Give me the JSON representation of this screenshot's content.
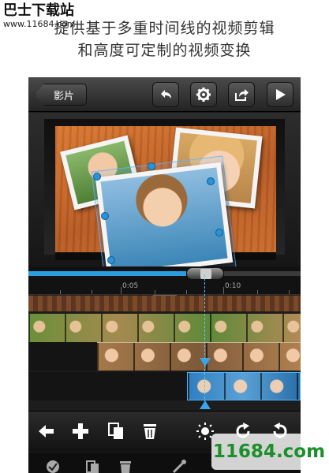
{
  "watermark": {
    "site_name": "巴士下载站",
    "site_url": "www.11684.com",
    "logo_text": "11684.com"
  },
  "caption": {
    "line1": "提供基于多重时间线的视频剪辑",
    "line2": "和高度可定制的视频变换"
  },
  "toolbar": {
    "back_label": "影片",
    "buttons": [
      "undo-icon",
      "gear-icon",
      "share-icon",
      "play-icon"
    ]
  },
  "preview": {
    "photos": [
      "child-with-teddy-photo",
      "girl-smiling-photo",
      "girl-holding-shell-photo"
    ],
    "selected_photo": "girl-holding-shell-photo"
  },
  "scrubber": {
    "position_fraction": 0.65
  },
  "ruler": {
    "ticks": [
      "0:05",
      "0:10"
    ]
  },
  "tracks": [
    {
      "name": "video-track-1",
      "clip": "girl-with-teddy-clip"
    },
    {
      "name": "video-track-2",
      "clip": "girl-holding-shell-clip"
    },
    {
      "name": "video-track-3",
      "clip": "girl-on-beach-clip"
    }
  ],
  "bottom_bar": {
    "icons": [
      "back-arrow-icon",
      "add-icon",
      "duplicate-icon",
      "delete-icon",
      "brightness-icon",
      "redo-icon",
      "rotate-icon"
    ]
  },
  "colors": {
    "accent": "#2a9de0",
    "toolbar": "#3a3a3a",
    "wood": "#c9692a",
    "logo": "#1a8f2a"
  }
}
